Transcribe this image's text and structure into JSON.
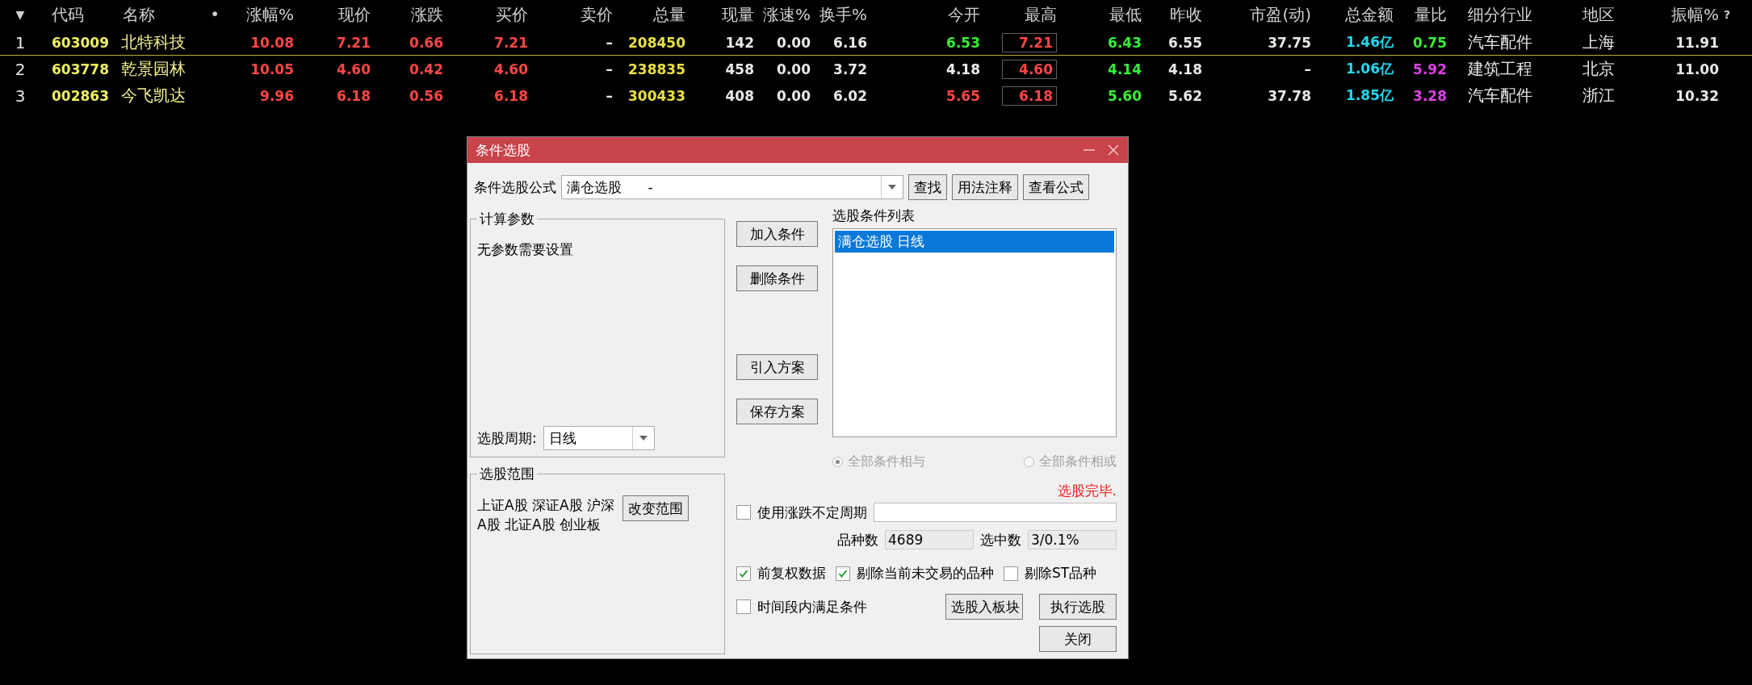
{
  "table": {
    "columns": [
      {
        "label": "▼",
        "kind": "index"
      },
      {
        "label": "代码",
        "kind": "code"
      },
      {
        "label": "名称",
        "kind": "name",
        "marker": "•"
      },
      {
        "label": "涨幅%",
        "kind": "price"
      },
      {
        "label": "现价",
        "kind": "price"
      },
      {
        "label": "涨跌",
        "kind": "price"
      },
      {
        "label": "买价",
        "kind": "price"
      },
      {
        "label": "卖价",
        "kind": "plain"
      },
      {
        "label": "总量",
        "kind": "volume"
      },
      {
        "label": "现量",
        "kind": "plain"
      },
      {
        "label": "涨速%",
        "kind": "plain"
      },
      {
        "label": "换手%",
        "kind": "plain"
      },
      {
        "label": "今开",
        "kind": "price"
      },
      {
        "label": "最高",
        "kind": "boxed"
      },
      {
        "label": "最低",
        "kind": "price"
      },
      {
        "label": "昨收",
        "kind": "plain"
      },
      {
        "label": "市盈(动)",
        "kind": "plain"
      },
      {
        "label": "总金额",
        "kind": "amount"
      },
      {
        "label": "量比",
        "kind": "price"
      },
      {
        "label": "细分行业",
        "kind": "text"
      },
      {
        "label": "地区",
        "kind": "region"
      },
      {
        "label": "振幅%",
        "kind": "plain"
      },
      {
        "label": "?",
        "kind": "help"
      }
    ],
    "rows": [
      {
        "selected": true,
        "cells": [
          {
            "text": "1"
          },
          {
            "text": "603009"
          },
          {
            "text": "北特科技"
          },
          {
            "text": "10.08",
            "color": "#ff4646"
          },
          {
            "text": "7.21",
            "color": "#ff4646"
          },
          {
            "text": "0.66",
            "color": "#ff4646"
          },
          {
            "text": "7.21",
            "color": "#ff4646"
          },
          {
            "text": "–"
          },
          {
            "text": "208450"
          },
          {
            "text": "142"
          },
          {
            "text": "0.00"
          },
          {
            "text": "6.16"
          },
          {
            "text": "6.53",
            "color": "#38f038"
          },
          {
            "text": "7.21",
            "color": "#ff4646"
          },
          {
            "text": "6.43",
            "color": "#38f038"
          },
          {
            "text": "6.55"
          },
          {
            "text": "37.75"
          },
          {
            "text": "1.46亿"
          },
          {
            "text": "0.75",
            "color": "#38f038"
          },
          {
            "text": "汽车配件"
          },
          {
            "text": "上海"
          },
          {
            "text": "11.91"
          }
        ]
      },
      {
        "selected": false,
        "cells": [
          {
            "text": "2"
          },
          {
            "text": "603778"
          },
          {
            "text": "乾景园林"
          },
          {
            "text": "10.05",
            "color": "#ff4646"
          },
          {
            "text": "4.60",
            "color": "#ff4646"
          },
          {
            "text": "0.42",
            "color": "#ff4646"
          },
          {
            "text": "4.60",
            "color": "#ff4646"
          },
          {
            "text": "–"
          },
          {
            "text": "238835"
          },
          {
            "text": "458"
          },
          {
            "text": "0.00"
          },
          {
            "text": "3.72"
          },
          {
            "text": "4.18",
            "color": "#eeeeee"
          },
          {
            "text": "4.60",
            "color": "#ff4646"
          },
          {
            "text": "4.14",
            "color": "#38f038"
          },
          {
            "text": "4.18"
          },
          {
            "text": "–"
          },
          {
            "text": "1.06亿"
          },
          {
            "text": "5.92",
            "color": "#e040e8"
          },
          {
            "text": "建筑工程"
          },
          {
            "text": "北京"
          },
          {
            "text": "11.00"
          }
        ]
      },
      {
        "selected": false,
        "cells": [
          {
            "text": "3"
          },
          {
            "text": "002863"
          },
          {
            "text": "今飞凯达"
          },
          {
            "text": "9.96",
            "color": "#ff4646"
          },
          {
            "text": "6.18",
            "color": "#ff4646"
          },
          {
            "text": "0.56",
            "color": "#ff4646"
          },
          {
            "text": "6.18",
            "color": "#ff4646"
          },
          {
            "text": "–"
          },
          {
            "text": "300433"
          },
          {
            "text": "408"
          },
          {
            "text": "0.00"
          },
          {
            "text": "6.02"
          },
          {
            "text": "5.65",
            "color": "#ff4646"
          },
          {
            "text": "6.18",
            "color": "#ff4646"
          },
          {
            "text": "5.60",
            "color": "#38f038"
          },
          {
            "text": "5.62"
          },
          {
            "text": "37.78"
          },
          {
            "text": "1.85亿"
          },
          {
            "text": "3.28",
            "color": "#e040e8"
          },
          {
            "text": "汽车配件"
          },
          {
            "text": "浙江"
          },
          {
            "text": "10.32"
          }
        ]
      }
    ]
  },
  "dialog": {
    "title": "条件选股",
    "formula": {
      "label": "条件选股公式",
      "value": "满仓选股      -"
    },
    "top_buttons": [
      "查找",
      "用法注释",
      "查看公式"
    ],
    "params": {
      "title": "计算参数",
      "message": "无参数需要设置",
      "period_label": "选股周期:",
      "period_value": "日线"
    },
    "middle_buttons": [
      "加入条件",
      "删除条件",
      "引入方案",
      "保存方案"
    ],
    "conditions": {
      "label": "选股条件列表",
      "items": [
        {
          "text": "满仓选股  日线",
          "selected": true
        }
      ]
    },
    "combine": [
      {
        "label": "全部条件相与",
        "selected": true,
        "disabled": true
      },
      {
        "label": "全部条件相或",
        "selected": false,
        "disabled": true
      }
    ],
    "status": "选股完毕.",
    "range": {
      "title": "选股范围",
      "text": "上证A股 深证A股 沪深A股 北证A股 创业板",
      "button": "改变范围"
    },
    "uncertain_period": {
      "label": "使用涨跌不定周期",
      "checked": false
    },
    "counts": [
      {
        "label": "品种数",
        "value": "4689"
      },
      {
        "label": "选中数",
        "value": "3/0.1%"
      }
    ],
    "options": [
      {
        "label": "前复权数据",
        "checked": true
      },
      {
        "label": "剔除当前未交易的品种",
        "checked": true
      },
      {
        "label": "剔除ST品种",
        "checked": false
      }
    ],
    "time_option": {
      "label": "时间段内满足条件",
      "checked": false
    },
    "action_buttons": [
      "选股入板块",
      "执行选股"
    ],
    "close_button": "关闭"
  }
}
